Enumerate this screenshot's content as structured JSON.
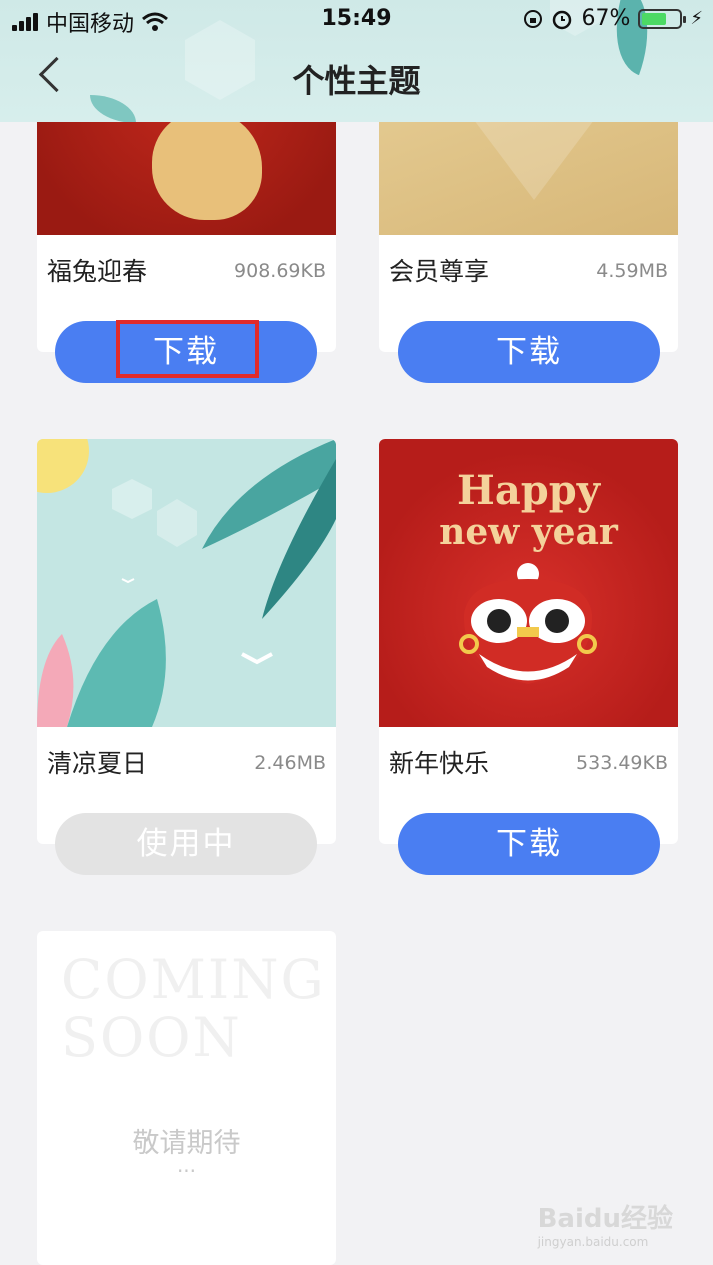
{
  "status_bar": {
    "carrier": "中国移动",
    "time": "15:49",
    "battery": "67%",
    "battery_level": 0.67
  },
  "header": {
    "title": "个性主题"
  },
  "themes": [
    {
      "name": "福兔迎春",
      "size": "908.69KB",
      "button": "下载",
      "state": "download"
    },
    {
      "name": "会员尊享",
      "size": "4.59MB",
      "button": "下载",
      "state": "download"
    },
    {
      "name": "清凉夏日",
      "size": "2.46MB",
      "button": "使用中",
      "state": "in-use"
    },
    {
      "name": "新年快乐",
      "size": "533.49KB",
      "button": "下载",
      "state": "download",
      "thumb_line1": "Happy",
      "thumb_line2": "new year"
    }
  ],
  "coming_soon": {
    "line1": "COMING",
    "line2": "SOON",
    "subtitle": "敬请期待",
    "dots": "···"
  },
  "watermark": {
    "brand": "Baidu经验",
    "url": "jingyan.baidu.com"
  },
  "colors": {
    "accent": "#4a7ef2",
    "highlight": "#e02b2b",
    "header_bg": "#d2ebe9"
  }
}
